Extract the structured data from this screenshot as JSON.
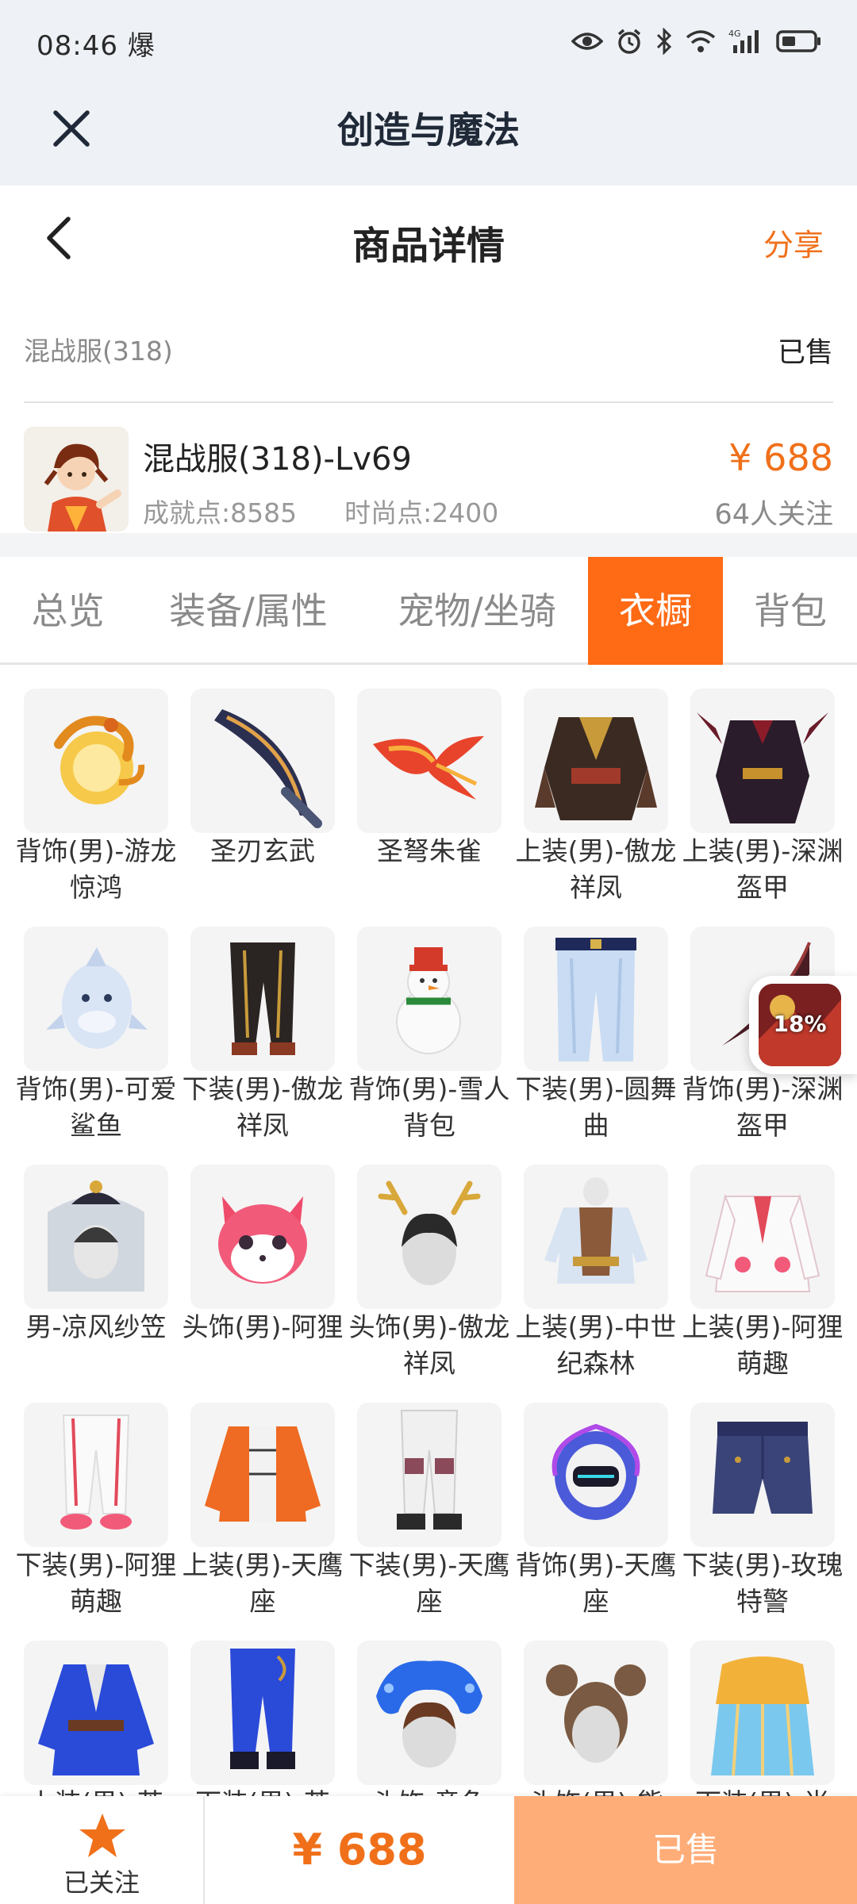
{
  "status_bar": {
    "time": "08:46 爆"
  },
  "mini_app": {
    "title": "创造与魔法"
  },
  "header": {
    "title": "商品详情",
    "share_label": "分享"
  },
  "server_row": {
    "server": "混战服(318)",
    "status": "已售"
  },
  "product": {
    "name": "混战服(318)-Lv69",
    "achievement": "成就点:8585",
    "fashion": "时尚点:2400",
    "price": "¥ 688",
    "followers": "64人关注"
  },
  "tabs": [
    {
      "label": "总览",
      "active": false
    },
    {
      "label": "装备/属性",
      "active": false
    },
    {
      "label": "宠物/坐骑",
      "active": false
    },
    {
      "label": "衣橱",
      "active": true
    },
    {
      "label": "背包",
      "active": false
    }
  ],
  "items": [
    {
      "name": "背饰(男)-游龙惊鸿",
      "icon": "golden-dragon-icon"
    },
    {
      "name": "圣刃玄武",
      "icon": "curved-blade-icon"
    },
    {
      "name": "圣弩朱雀",
      "icon": "phoenix-crossbow-icon"
    },
    {
      "name": "上装(男)-傲龙祥凤",
      "icon": "dragon-armor-top-icon"
    },
    {
      "name": "上装(男)-深渊盔甲",
      "icon": "abyss-armor-top-icon"
    },
    {
      "name": "背饰(男)-可爱鲨鱼",
      "icon": "shark-backpack-icon"
    },
    {
      "name": "下装(男)-傲龙祥凤",
      "icon": "dragon-pants-icon"
    },
    {
      "name": "背饰(男)-雪人背包",
      "icon": "snowman-backpack-icon"
    },
    {
      "name": "下装(男)-圆舞曲",
      "icon": "waltz-pants-icon"
    },
    {
      "name": "背饰(男)-深渊盔甲",
      "icon": "abyss-wing-icon"
    },
    {
      "name": "男-凉风纱笠",
      "icon": "veil-hat-icon"
    },
    {
      "name": "头饰(男)-阿狸",
      "icon": "ahri-fox-head-icon"
    },
    {
      "name": "头饰(男)-傲龙祥凤",
      "icon": "antler-head-icon"
    },
    {
      "name": "上装(男)-中世纪森林",
      "icon": "medieval-top-icon"
    },
    {
      "name": "上装(男)-阿狸萌趣",
      "icon": "ahri-jacket-icon"
    },
    {
      "name": "下装(男)-阿狸萌趣",
      "icon": "white-pants-icon"
    },
    {
      "name": "上装(男)-天鹰座",
      "icon": "aquila-top-icon"
    },
    {
      "name": "下装(男)-天鹰座",
      "icon": "aquila-pants-icon"
    },
    {
      "name": "背饰(男)-天鹰座",
      "icon": "aquila-backpack-icon"
    },
    {
      "name": "下装(男)-玫瑰特警",
      "icon": "rose-shorts-icon"
    },
    {
      "name": "上装(男)-苍",
      "icon": "blue-robe-icon"
    },
    {
      "name": "下装(男)-苍",
      "icon": "blue-pants-icon"
    },
    {
      "name": "头饰-章鱼",
      "icon": "octopus-head-icon"
    },
    {
      "name": "头饰(男)-熊",
      "icon": "bear-ears-head-icon"
    },
    {
      "name": "下装(男)-尚",
      "icon": "golden-skirt-icon"
    }
  ],
  "float_badge": {
    "percent": "18%"
  },
  "bottom_bar": {
    "follow_label": "已关注",
    "price": "¥ 688",
    "sold_label": "已售"
  },
  "colors": {
    "accent": "#ff6a14",
    "price": "#f0701a",
    "sold_button": "#ffad78"
  }
}
